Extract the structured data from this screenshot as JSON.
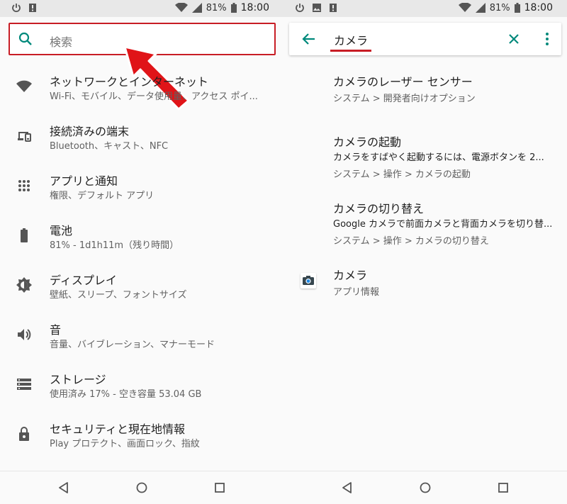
{
  "status": {
    "battery_pct": "81%",
    "time": "18:00"
  },
  "left": {
    "search_placeholder": "検索",
    "items": [
      {
        "icon": "wifi-icon",
        "title": "ネットワークとインターネット",
        "sub": "Wi-Fi、モバイル、データ使用量、アクセス ポイ..."
      },
      {
        "icon": "devices-icon",
        "title": "接続済みの端末",
        "sub": "Bluetooth、キャスト、NFC"
      },
      {
        "icon": "apps-icon",
        "title": "アプリと通知",
        "sub": "権限、デフォルト アプリ"
      },
      {
        "icon": "battery-icon",
        "title": "電池",
        "sub": "81% - 1d1h11m（残り時間）"
      },
      {
        "icon": "brightness-icon",
        "title": "ディスプレイ",
        "sub": "壁紙、スリープ、フォントサイズ"
      },
      {
        "icon": "volume-icon",
        "title": "音",
        "sub": "音量、バイブレーション、マナーモード"
      },
      {
        "icon": "storage-icon",
        "title": "ストレージ",
        "sub": "使用済み 17% - 空き容量 53.04 GB"
      },
      {
        "icon": "lock-icon",
        "title": "セキュリティと現在地情報",
        "sub": "Play プロテクト、画面ロック、指紋"
      }
    ]
  },
  "right": {
    "query": "カメラ",
    "results": [
      {
        "title": "カメラのレーザー センサー",
        "summary": "",
        "path": "システム > 開発者向けオプション"
      },
      {
        "title": "カメラの起動",
        "summary": "カメラをすばやく起動するには、電源ボタンを 2...",
        "path": "システム > 操作 > カメラの起動"
      },
      {
        "title": "カメラの切り替え",
        "summary": "Google カメラで前面カメラと背面カメラを切り替...",
        "path": "システム > 操作 > カメラの切り替え"
      },
      {
        "title": "カメラ",
        "summary": "",
        "path": "アプリ情報"
      }
    ]
  },
  "colors": {
    "accent": "#00897b",
    "highlight": "#c81d25",
    "text": "#212121",
    "secondary": "#616161"
  }
}
